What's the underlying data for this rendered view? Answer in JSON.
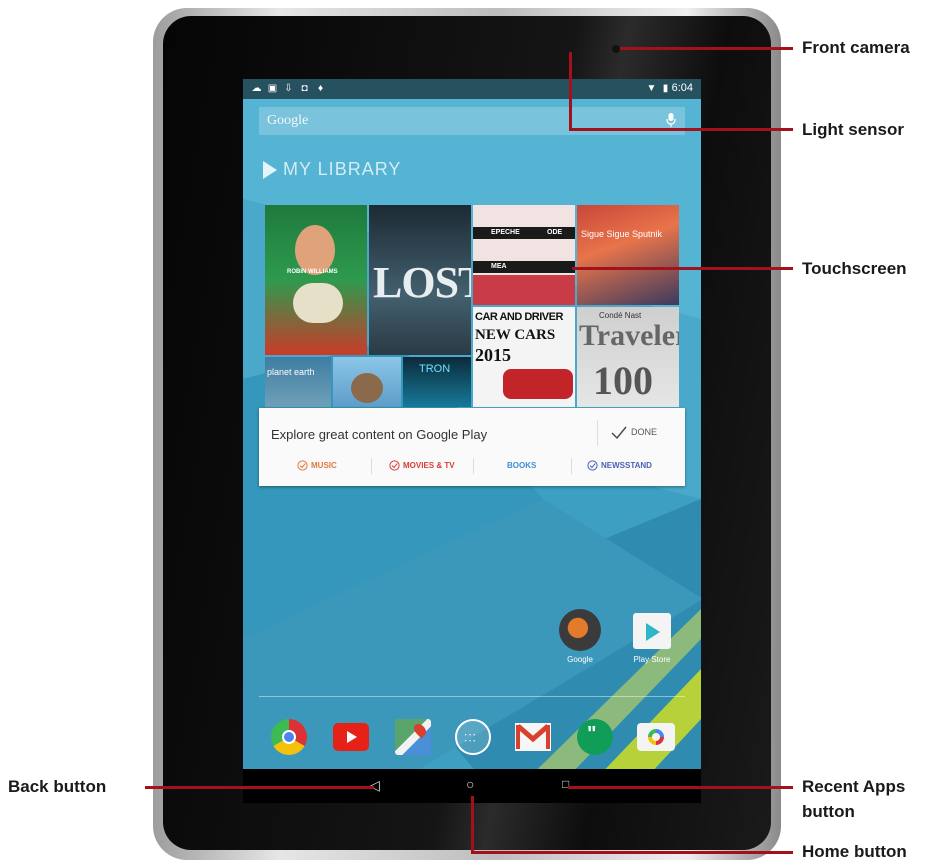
{
  "status_bar": {
    "time": "6:04"
  },
  "search": {
    "label": "Google"
  },
  "library": {
    "title": "MY LIBRARY",
    "tiles": {
      "robin_label": "ROBIN WILLIAMS",
      "lost": "LOST",
      "depeche1": "EPECHE",
      "depeche2": "ODE",
      "depeche3": "MEA",
      "sigue": "Sigue Sigue Sputnik",
      "car_driver": "CAR AND DRIVER",
      "new_cars": "NEW CARS",
      "year": "2015",
      "conde": "Condé Nast",
      "traveler": "Traveler",
      "hundred": "100",
      "planet": "planet earth",
      "tron": "TRON"
    }
  },
  "card": {
    "text": "Explore great content on Google Play",
    "done": "DONE",
    "categories": [
      {
        "label": "MUSIC",
        "color": "#e4783a"
      },
      {
        "label": "MOVIES & TV",
        "color": "#d93c36"
      },
      {
        "label": "BOOKS",
        "color": "#3b8fd6"
      },
      {
        "label": "NEWSSTAND",
        "color": "#4a5fb8"
      }
    ]
  },
  "home_apps": {
    "google": "Google",
    "play_store": "Play Store"
  },
  "dock": [
    "chrome-icon",
    "youtube-icon",
    "maps-icon",
    "app-drawer-icon",
    "gmail-icon",
    "hangouts-icon",
    "camera-icon"
  ],
  "annotations": {
    "front_camera": "Front camera",
    "light_sensor": "Light sensor",
    "touchscreen": "Touchscreen",
    "back_button": "Back button",
    "recent_apps_1": "Recent Apps",
    "recent_apps_2": "button",
    "home_button": "Home button"
  },
  "colors": {
    "callout": "#a3111b",
    "wallpaper": "#3a9ec1"
  }
}
